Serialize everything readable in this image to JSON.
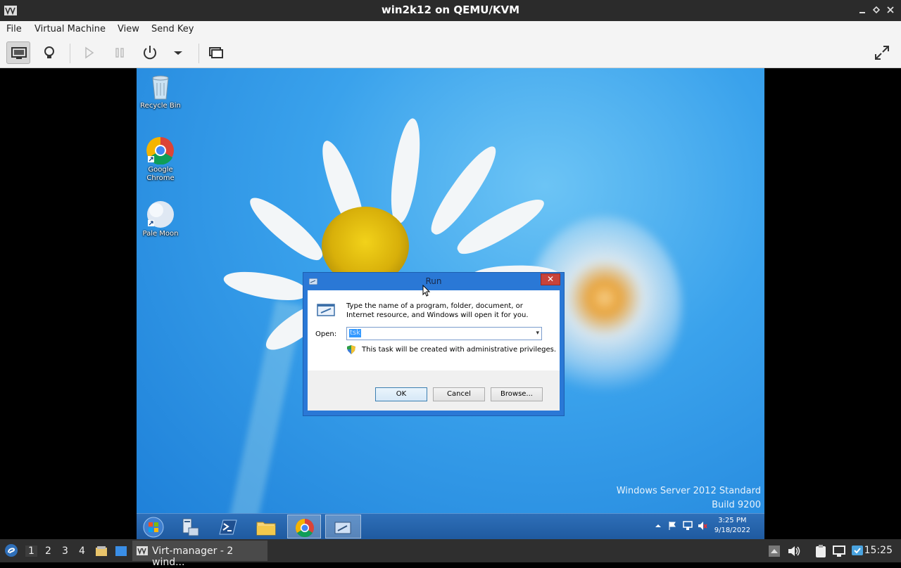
{
  "window": {
    "title": "win2k12 on QEMU/KVM"
  },
  "menu": {
    "file": "File",
    "vm": "Virtual Machine",
    "view": "View",
    "sendkey": "Send Key"
  },
  "desktop": {
    "icons": [
      {
        "label": "Recycle Bin"
      },
      {
        "label_line1": "Google",
        "label_line2": "Chrome"
      },
      {
        "label": "Pale Moon"
      }
    ],
    "watermark_line1": "Windows Server 2012 Standard",
    "watermark_line2": "Build 9200"
  },
  "run_dialog": {
    "title": "Run",
    "close": "✕",
    "description": "Type the name of a program, folder, document, or Internet resource, and Windows will open it for you.",
    "open_label": "Open:",
    "open_value": "tsk",
    "admin_note": "This task will be created with administrative privileges.",
    "ok": "OK",
    "cancel": "Cancel",
    "browse": "Browse..."
  },
  "guest_taskbar": {
    "time": "3:25 PM",
    "date": "9/18/2022"
  },
  "host_panel": {
    "workspaces": [
      "1",
      "2",
      "3",
      "4"
    ],
    "task_label": "Virt-manager - 2 wind...",
    "clock": "15:25"
  },
  "colors": {
    "titlebar": "#2b2b2b",
    "toolbar": "#f4f4f4",
    "run_frame": "#2a78d6",
    "panel": "#2f2f2f"
  }
}
